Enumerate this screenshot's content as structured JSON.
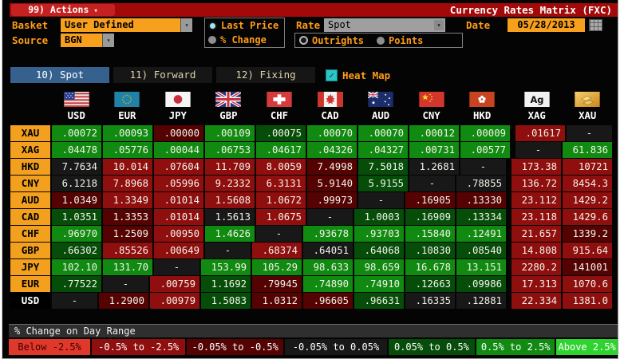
{
  "window": {
    "actions_label": "99) Actions",
    "title": "Currency Rates Matrix (FXC)"
  },
  "controls": {
    "basket": {
      "label": "Basket",
      "value": "User Defined"
    },
    "source": {
      "label": "Source",
      "value": "BGN"
    },
    "price_mode": [
      {
        "label": "Last Price",
        "selected": true,
        "dot": "cyan"
      },
      {
        "label": "% Change",
        "selected": false
      }
    ],
    "rate": {
      "label": "Rate",
      "value": "Spot"
    },
    "rate_mode": [
      {
        "label": "Outrights",
        "selected": true,
        "dot": "dark"
      },
      {
        "label": "Points",
        "selected": false
      }
    ],
    "date": {
      "label": "Date",
      "value": "05/28/2013"
    }
  },
  "tabs": [
    {
      "label": "10) Spot",
      "selected": true
    },
    {
      "label": "11) Forward",
      "selected": false
    },
    {
      "label": "12) Fixing",
      "selected": false
    }
  ],
  "heat_map": {
    "label": "Heat Map",
    "checked": true
  },
  "matrix": {
    "columns": [
      {
        "code": "USD",
        "icon": "us-flag-icon"
      },
      {
        "code": "EUR",
        "icon": "eu-flag-icon"
      },
      {
        "code": "JPY",
        "icon": "japan-flag-icon"
      },
      {
        "code": "GBP",
        "icon": "uk-flag-icon"
      },
      {
        "code": "CHF",
        "icon": "switzerland-flag-icon"
      },
      {
        "code": "CAD",
        "icon": "canada-flag-icon"
      },
      {
        "code": "AUD",
        "icon": "australia-flag-icon"
      },
      {
        "code": "CNY",
        "icon": "china-flag-icon"
      },
      {
        "code": "HKD",
        "icon": "hong-kong-flag-icon"
      },
      {
        "code": "XAG",
        "icon": "silver-icon"
      },
      {
        "code": "XAU",
        "icon": "gold-icon"
      }
    ],
    "rows": [
      {
        "code": "XAU",
        "cells": [
          {
            "v": ".00072",
            "b": "up2"
          },
          {
            "v": ".00093",
            "b": "up2"
          },
          {
            "v": ".00000",
            "b": "dn1"
          },
          {
            "v": ".00109",
            "b": "up2"
          },
          {
            "v": ".00075",
            "b": "up1"
          },
          {
            "v": ".00070",
            "b": "up2"
          },
          {
            "v": ".00070",
            "b": "up2"
          },
          {
            "v": ".00012",
            "b": "up2"
          },
          {
            "v": ".00009",
            "b": "up2"
          },
          {
            "v": ".01617",
            "b": "dn2"
          },
          {
            "v": "-",
            "b": "flat"
          }
        ]
      },
      {
        "code": "XAG",
        "cells": [
          {
            "v": ".04478",
            "b": "up2"
          },
          {
            "v": ".05776",
            "b": "up2"
          },
          {
            "v": ".00044",
            "b": "up2"
          },
          {
            "v": ".06753",
            "b": "up2"
          },
          {
            "v": ".04617",
            "b": "up2"
          },
          {
            "v": ".04326",
            "b": "up2"
          },
          {
            "v": ".04327",
            "b": "up2"
          },
          {
            "v": ".00731",
            "b": "up2"
          },
          {
            "v": ".00577",
            "b": "up2"
          },
          {
            "v": "-",
            "b": "flat"
          },
          {
            "v": "61.836",
            "b": "up2"
          }
        ]
      },
      {
        "code": "HKD",
        "cells": [
          {
            "v": "7.7634",
            "b": "flat"
          },
          {
            "v": "10.014",
            "b": "dn2"
          },
          {
            "v": ".07604",
            "b": "dn2"
          },
          {
            "v": "11.709",
            "b": "dn2"
          },
          {
            "v": "8.0059",
            "b": "dn2"
          },
          {
            "v": "7.4998",
            "b": "dn1"
          },
          {
            "v": "7.5018",
            "b": "up1"
          },
          {
            "v": "1.2681",
            "b": "flat"
          },
          {
            "v": "-",
            "b": "flat"
          },
          {
            "v": "173.38",
            "b": "dn2"
          },
          {
            "v": "10721",
            "b": "dn2"
          }
        ]
      },
      {
        "code": "CNY",
        "cells": [
          {
            "v": "6.1218",
            "b": "flat"
          },
          {
            "v": "7.8968",
            "b": "dn2"
          },
          {
            "v": ".05996",
            "b": "dn2"
          },
          {
            "v": "9.2332",
            "b": "dn2"
          },
          {
            "v": "6.3131",
            "b": "dn2"
          },
          {
            "v": "5.9140",
            "b": "dn1"
          },
          {
            "v": "5.9155",
            "b": "up1"
          },
          {
            "v": "-",
            "b": "flat"
          },
          {
            "v": ".78855",
            "b": "flat"
          },
          {
            "v": "136.72",
            "b": "dn2"
          },
          {
            "v": "8454.3",
            "b": "dn2"
          }
        ]
      },
      {
        "code": "AUD",
        "cells": [
          {
            "v": "1.0349",
            "b": "dn1"
          },
          {
            "v": "1.3349",
            "b": "dn2"
          },
          {
            "v": ".01014",
            "b": "dn2"
          },
          {
            "v": "1.5608",
            "b": "dn2"
          },
          {
            "v": "1.0672",
            "b": "dn2"
          },
          {
            "v": ".99973",
            "b": "dn1"
          },
          {
            "v": "-",
            "b": "flat"
          },
          {
            "v": ".16905",
            "b": "dn1"
          },
          {
            "v": ".13330",
            "b": "dn1"
          },
          {
            "v": "23.112",
            "b": "dn2"
          },
          {
            "v": "1429.2",
            "b": "dn2"
          }
        ]
      },
      {
        "code": "CAD",
        "cells": [
          {
            "v": "1.0351",
            "b": "up1"
          },
          {
            "v": "1.3353",
            "b": "dn1"
          },
          {
            "v": ".01014",
            "b": "dn2"
          },
          {
            "v": "1.5613",
            "b": "flat"
          },
          {
            "v": "1.0675",
            "b": "dn2"
          },
          {
            "v": "-",
            "b": "flat"
          },
          {
            "v": "1.0003",
            "b": "up1"
          },
          {
            "v": ".16909",
            "b": "up1"
          },
          {
            "v": ".13334",
            "b": "up1"
          },
          {
            "v": "23.118",
            "b": "dn2"
          },
          {
            "v": "1429.6",
            "b": "dn2"
          }
        ]
      },
      {
        "code": "CHF",
        "cells": [
          {
            "v": ".96970",
            "b": "up2"
          },
          {
            "v": "1.2509",
            "b": "dn1"
          },
          {
            "v": ".00950",
            "b": "dn2"
          },
          {
            "v": "1.4626",
            "b": "up2"
          },
          {
            "v": "-",
            "b": "flat"
          },
          {
            "v": ".93678",
            "b": "up2"
          },
          {
            "v": ".93703",
            "b": "up2"
          },
          {
            "v": ".15840",
            "b": "up2"
          },
          {
            "v": ".12491",
            "b": "up2"
          },
          {
            "v": "21.657",
            "b": "dn2"
          },
          {
            "v": "1339.2",
            "b": "dn1"
          }
        ]
      },
      {
        "code": "GBP",
        "cells": [
          {
            "v": ".66302",
            "b": "up1"
          },
          {
            "v": ".85526",
            "b": "dn2"
          },
          {
            "v": ".00649",
            "b": "dn2"
          },
          {
            "v": "-",
            "b": "flat"
          },
          {
            "v": ".68374",
            "b": "dn2"
          },
          {
            "v": ".64051",
            "b": "flat"
          },
          {
            "v": ".64068",
            "b": "up1"
          },
          {
            "v": ".10830",
            "b": "up1"
          },
          {
            "v": ".08540",
            "b": "up1"
          },
          {
            "v": "14.808",
            "b": "dn2"
          },
          {
            "v": "915.64",
            "b": "dn2"
          }
        ]
      },
      {
        "code": "JPY",
        "cells": [
          {
            "v": "102.10",
            "b": "up2"
          },
          {
            "v": "131.70",
            "b": "up2"
          },
          {
            "v": "-",
            "b": "flat"
          },
          {
            "v": "153.99",
            "b": "up2"
          },
          {
            "v": "105.29",
            "b": "up2"
          },
          {
            "v": "98.633",
            "b": "up2"
          },
          {
            "v": "98.659",
            "b": "up2"
          },
          {
            "v": "16.678",
            "b": "up2"
          },
          {
            "v": "13.151",
            "b": "up2"
          },
          {
            "v": "2280.2",
            "b": "dn2"
          },
          {
            "v": "141001",
            "b": "dn1"
          }
        ]
      },
      {
        "code": "EUR",
        "cells": [
          {
            "v": ".77522",
            "b": "up1"
          },
          {
            "v": "-",
            "b": "flat"
          },
          {
            "v": ".00759",
            "b": "dn2"
          },
          {
            "v": "1.1692",
            "b": "up1"
          },
          {
            "v": ".79945",
            "b": "dn1"
          },
          {
            "v": ".74890",
            "b": "up2"
          },
          {
            "v": ".74910",
            "b": "up2"
          },
          {
            "v": ".12663",
            "b": "up1"
          },
          {
            "v": ".09986",
            "b": "up1"
          },
          {
            "v": "17.313",
            "b": "dn2"
          },
          {
            "v": "1070.6",
            "b": "dn2"
          }
        ]
      },
      {
        "code": "USD",
        "label_style": "dark",
        "cells": [
          {
            "v": "-",
            "b": "flat"
          },
          {
            "v": "1.2900",
            "b": "dn1"
          },
          {
            "v": ".00979",
            "b": "dn2"
          },
          {
            "v": "1.5083",
            "b": "up1"
          },
          {
            "v": "1.0312",
            "b": "dn1"
          },
          {
            "v": ".96605",
            "b": "dn1"
          },
          {
            "v": ".96631",
            "b": "up1"
          },
          {
            "v": ".16335",
            "b": "flat"
          },
          {
            "v": ".12881",
            "b": "flat"
          },
          {
            "v": "22.334",
            "b": "dn2"
          },
          {
            "v": "1381.0",
            "b": "dn2"
          }
        ]
      }
    ]
  },
  "legend": {
    "title": "% Change on Day Range",
    "buckets": [
      {
        "label": "Below -2.5%",
        "key": "dn3"
      },
      {
        "label": "-0.5% to -2.5%",
        "key": "dn2"
      },
      {
        "label": "-0.05% to -0.5%",
        "key": "dn1"
      },
      {
        "label": "-0.05% to 0.05%",
        "key": "flat"
      },
      {
        "label": "0.05% to 0.5%",
        "key": "up1"
      },
      {
        "label": "0.5% to 2.5%",
        "key": "up2"
      },
      {
        "label": "Above 2.5%",
        "key": "up3"
      }
    ]
  },
  "colors": {
    "dn3": "#e0392c",
    "dn2": "#8f0e0e",
    "dn1": "#550202",
    "flat": "#181818",
    "up1": "#064d09",
    "up2": "#108a10",
    "up3": "#2fd32f",
    "accent_amber": "#f7a01d",
    "label_orange": "#ff9c1a",
    "titlebar_red": "#a30909",
    "selected_tab_blue": "#36618f",
    "heat_check_teal": "#2cc5c5"
  }
}
